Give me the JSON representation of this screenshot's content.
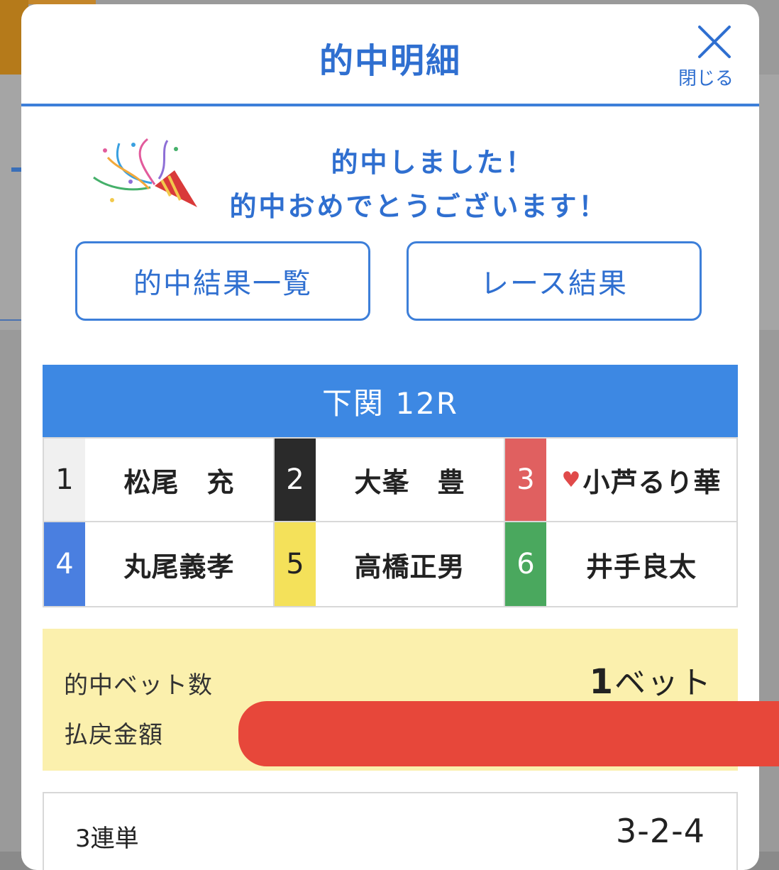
{
  "modal": {
    "title": "的中明細",
    "close_label": "閉じる"
  },
  "congrats": {
    "line1": "的中しました！",
    "line2": "的中おめでとうございます！"
  },
  "buttons": {
    "hit_results": "的中結果一覧",
    "race_results": "レース結果"
  },
  "race": {
    "title": "下関 12R",
    "racers": [
      {
        "lane": "1",
        "name": "松尾　充",
        "color": "#f0f0f0",
        "text_color": "#222222"
      },
      {
        "lane": "2",
        "name": "大峯　豊",
        "color": "#2a2a2a",
        "text_color": "#ffffff"
      },
      {
        "lane": "3",
        "name": "小芦るり華",
        "color": "#e06060",
        "text_color": "#ffffff",
        "heart": "♥"
      },
      {
        "lane": "4",
        "name": "丸尾義孝",
        "color": "#4a7fe0",
        "text_color": "#ffffff"
      },
      {
        "lane": "5",
        "name": "高橋正男",
        "color": "#f4e15a",
        "text_color": "#222222"
      },
      {
        "lane": "6",
        "name": "井手良太",
        "color": "#4aa85e",
        "text_color": "#ffffff"
      }
    ]
  },
  "summary": {
    "bets_label": "的中ベット数",
    "bets_count": "1",
    "bets_unit": "ベット",
    "payout_label": "払戻金額"
  },
  "ticket": {
    "type": "3連単",
    "combo": "3-2-4"
  }
}
